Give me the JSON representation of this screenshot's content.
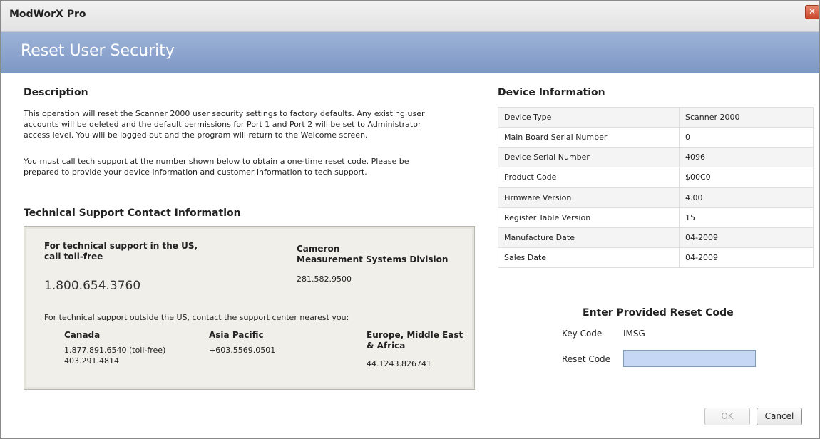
{
  "window": {
    "app_title": "ModWorX Pro",
    "close_glyph": "✕"
  },
  "banner": {
    "title": "Reset User Security"
  },
  "description": {
    "heading": "Description",
    "paragraph1_lines": [
      "This operation will reset the Scanner 2000 user security settings to factory defaults. Any existing user",
      "accounts will be deleted and the default permissions for Port 1 and Port 2 will be set to Administrator",
      "access level. You will be logged out and the program will return to the Welcome screen."
    ],
    "paragraph2_lines": [
      "You must call tech support at the number shown below to obtain a one-time reset code. Please be",
      "prepared to provide your device information and customer information to tech support."
    ]
  },
  "support": {
    "heading": "Technical Support Contact Information",
    "us_label_line1": "For technical support in the US,",
    "us_label_line2": "call toll-free",
    "us_phone": "1.800.654.3760",
    "cameron_line1": "Cameron",
    "cameron_line2": "Measurement Systems Division",
    "cameron_phone": "281.582.9500",
    "outside_text": "For technical support outside the US, contact the support center nearest you:",
    "canada_label": "Canada",
    "canada_phone1": "1.877.891.6540 (toll-free)",
    "canada_phone2": "403.291.4814",
    "asia_label": "Asia Pacific",
    "asia_phone": "+603.5569.0501",
    "europe_label_line1": "Europe, Middle East",
    "europe_label_line2": "& Africa",
    "europe_phone": "44.1243.826741"
  },
  "device_info": {
    "heading": "Device Information",
    "rows": [
      {
        "label": "Device Type",
        "value": "Scanner 2000"
      },
      {
        "label": "Main Board Serial Number",
        "value": "0"
      },
      {
        "label": "Device Serial Number",
        "value": "4096"
      },
      {
        "label": "Product Code",
        "value": "$00C0"
      },
      {
        "label": "Firmware Version",
        "value": "4.00"
      },
      {
        "label": "Register Table Version",
        "value": "15"
      },
      {
        "label": "Manufacture Date",
        "value": "04-2009"
      },
      {
        "label": "Sales Date",
        "value": "04-2009"
      }
    ]
  },
  "reset_code": {
    "heading": "Enter Provided Reset Code",
    "key_code_label": "Key Code",
    "key_code_value": "IMSG",
    "reset_code_label": "Reset Code",
    "reset_code_value": ""
  },
  "buttons": {
    "ok_label": "OK",
    "cancel_label": "Cancel"
  }
}
